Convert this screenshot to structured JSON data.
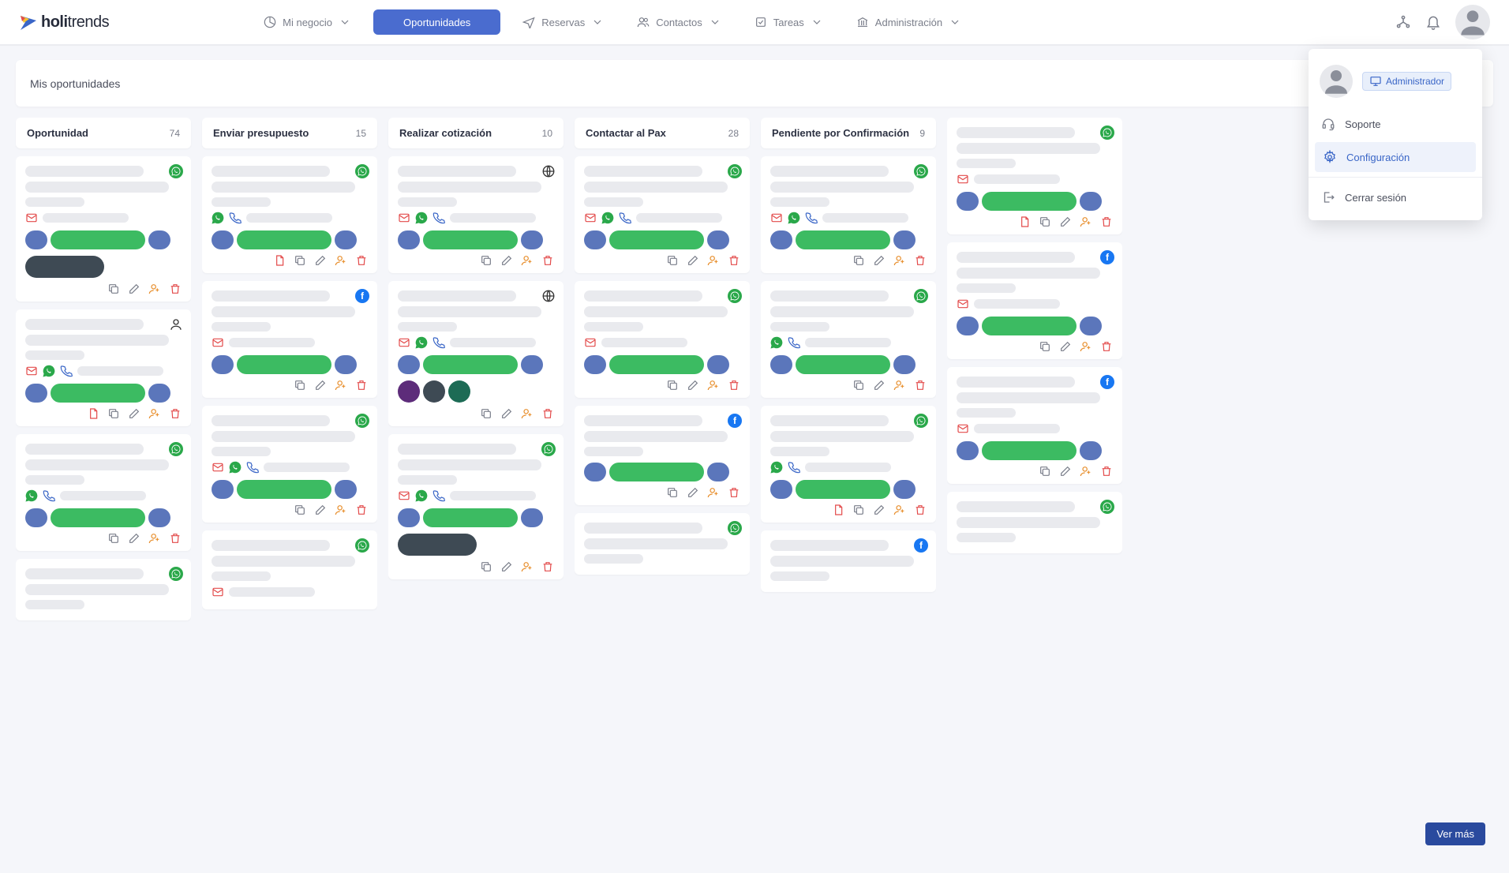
{
  "brand": {
    "name_bold": "holi",
    "name_light": "trends"
  },
  "nav": {
    "items": [
      {
        "label": "Mi negocio",
        "icon": "pie"
      },
      {
        "label": "Oportunidades",
        "icon": "box",
        "active": true
      },
      {
        "label": "Reservas",
        "icon": "plane"
      },
      {
        "label": "Contactos",
        "icon": "users"
      },
      {
        "label": "Tareas",
        "icon": "check"
      },
      {
        "label": "Administración",
        "icon": "bank"
      }
    ]
  },
  "subheader": {
    "title": "Mis oportunidades",
    "create_label": "+",
    "help_label": "?"
  },
  "dropdown": {
    "role": "Administrador",
    "items": [
      {
        "label": "Soporte",
        "icon": "headset"
      },
      {
        "label": "Configuración",
        "icon": "gear",
        "highlight": true
      },
      {
        "label": "Cerrar sesión",
        "icon": "logout",
        "separated": true
      }
    ]
  },
  "ver_mas": "Ver más",
  "columns": [
    {
      "title": "Oportunidad",
      "count": 74,
      "cards": [
        {
          "source": "whatsapp",
          "contacts": [
            "mail"
          ],
          "pills": [
            "blue",
            "green",
            "blue"
          ],
          "tags": [
            "dark"
          ],
          "actions": [
            "copy",
            "edit",
            "assign",
            "delete"
          ]
        },
        {
          "source": "person",
          "contacts": [
            "mail",
            "wa",
            "phone"
          ],
          "pills": [
            "blue",
            "green",
            "blue"
          ],
          "actions": [
            "pdf",
            "copy",
            "edit",
            "assign",
            "delete"
          ]
        },
        {
          "source": "whatsapp",
          "contacts": [
            "wa",
            "phone"
          ],
          "pills": [
            "blue",
            "green",
            "blue"
          ],
          "actions": [
            "copy",
            "edit",
            "assign",
            "delete"
          ]
        },
        {
          "source": "whatsapp",
          "contacts": [],
          "pills": [],
          "actions": []
        }
      ]
    },
    {
      "title": "Enviar presupuesto",
      "count": 15,
      "cards": [
        {
          "source": "whatsapp",
          "contacts": [
            "wa",
            "phone"
          ],
          "pills": [
            "blue",
            "green",
            "blue"
          ],
          "actions": [
            "pdf",
            "copy",
            "edit",
            "assign",
            "delete"
          ]
        },
        {
          "source": "facebook",
          "contacts": [
            "mail"
          ],
          "pills": [
            "blue",
            "green",
            "blue"
          ],
          "actions": [
            "copy",
            "edit",
            "assign",
            "delete"
          ]
        },
        {
          "source": "whatsapp",
          "contacts": [
            "mail",
            "wa",
            "phone"
          ],
          "pills": [
            "blue",
            "green",
            "blue"
          ],
          "actions": [
            "copy",
            "edit",
            "assign",
            "delete"
          ]
        },
        {
          "source": "whatsapp",
          "contacts": [
            "mail"
          ],
          "pills": [],
          "actions": []
        }
      ]
    },
    {
      "title": "Realizar cotización",
      "count": 10,
      "cards": [
        {
          "source": "globe",
          "contacts": [
            "mail",
            "wa",
            "phone"
          ],
          "pills": [
            "blue",
            "green",
            "blue"
          ],
          "actions": [
            "copy",
            "edit",
            "assign",
            "delete"
          ]
        },
        {
          "source": "globe",
          "contacts": [
            "mail",
            "wa",
            "phone"
          ],
          "pills": [
            "blue",
            "green",
            "blue"
          ],
          "tags": [
            "purple",
            "dark",
            "teal"
          ],
          "actions": [
            "copy",
            "edit",
            "assign",
            "delete"
          ]
        },
        {
          "source": "whatsapp",
          "contacts": [
            "mail",
            "wa",
            "phone"
          ],
          "pills": [
            "blue",
            "green",
            "blue"
          ],
          "tags": [
            "dark"
          ],
          "actions": [
            "copy",
            "edit",
            "assign",
            "delete"
          ]
        }
      ]
    },
    {
      "title": "Contactar al Pax",
      "count": 28,
      "cards": [
        {
          "source": "whatsapp",
          "contacts": [
            "mail",
            "wa",
            "phone"
          ],
          "pills": [
            "blue",
            "green",
            "blue"
          ],
          "actions": [
            "copy",
            "edit",
            "assign",
            "delete"
          ]
        },
        {
          "source": "whatsapp",
          "contacts": [
            "mail"
          ],
          "pills": [
            "blue",
            "green",
            "blue"
          ],
          "actions": [
            "copy",
            "edit",
            "assign",
            "delete"
          ]
        },
        {
          "source": "facebook",
          "contacts": [],
          "pills": [
            "blue",
            "green",
            "blue"
          ],
          "actions": [
            "copy",
            "edit",
            "assign",
            "delete"
          ]
        },
        {
          "source": "whatsapp",
          "contacts": [],
          "pills": [],
          "actions": []
        }
      ]
    },
    {
      "title": "Pendiente por Confirmación",
      "count": 9,
      "cards": [
        {
          "source": "whatsapp",
          "contacts": [
            "mail",
            "wa",
            "phone"
          ],
          "pills": [
            "blue",
            "green",
            "blue"
          ],
          "actions": [
            "copy",
            "edit",
            "assign",
            "delete"
          ]
        },
        {
          "source": "whatsapp",
          "contacts": [
            "wa",
            "phone"
          ],
          "pills": [
            "blue",
            "green",
            "blue"
          ],
          "actions": [
            "copy",
            "edit",
            "assign",
            "delete"
          ]
        },
        {
          "source": "whatsapp",
          "contacts": [
            "wa",
            "phone"
          ],
          "pills": [
            "blue",
            "green",
            "blue"
          ],
          "actions": [
            "pdf",
            "copy",
            "edit",
            "assign",
            "delete"
          ]
        },
        {
          "source": "facebook",
          "contacts": [],
          "pills": [],
          "actions": []
        }
      ]
    },
    {
      "title": "",
      "count": "",
      "cards": [
        {
          "source": "whatsapp",
          "contacts": [
            "mail"
          ],
          "pills": [
            "blue",
            "green",
            "blue"
          ],
          "actions": [
            "pdf",
            "copy",
            "edit",
            "assign",
            "delete"
          ]
        },
        {
          "source": "facebook",
          "contacts": [
            "mail"
          ],
          "pills": [
            "blue",
            "green",
            "blue"
          ],
          "actions": [
            "copy",
            "edit",
            "assign",
            "delete"
          ]
        },
        {
          "source": "facebook",
          "contacts": [
            "mail"
          ],
          "pills": [
            "blue",
            "green",
            "blue"
          ],
          "actions": [
            "copy",
            "edit",
            "assign",
            "delete"
          ]
        },
        {
          "source": "whatsapp",
          "contacts": [],
          "pills": [],
          "actions": []
        }
      ]
    }
  ]
}
